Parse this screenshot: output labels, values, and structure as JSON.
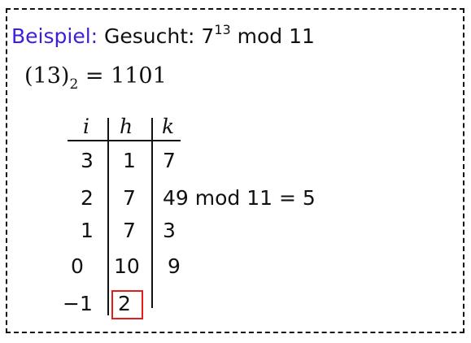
{
  "example": {
    "label": "Beispiel:",
    "text": "Gesucht: 7",
    "exponent": "13",
    "suffix": "mod 11"
  },
  "binary": {
    "open": "(13)",
    "base": "2",
    "rest": "= 1101"
  },
  "table": {
    "headers": {
      "i": "i",
      "h": "h",
      "k": "k"
    },
    "rows": [
      {
        "i": "3",
        "h": "1",
        "k": "7"
      },
      {
        "i": "2",
        "h": "7",
        "k": "49 mod 11 = 5"
      },
      {
        "i": "1",
        "h": "7",
        "k": "3"
      },
      {
        "i": "0",
        "h": "10",
        "k": "9"
      },
      {
        "i": "−1",
        "h": "2",
        "k": ""
      }
    ],
    "highlight_color": "#e41c1c"
  },
  "colors": {
    "accent": "#3a1fe0",
    "highlight": "#e41c1c"
  }
}
